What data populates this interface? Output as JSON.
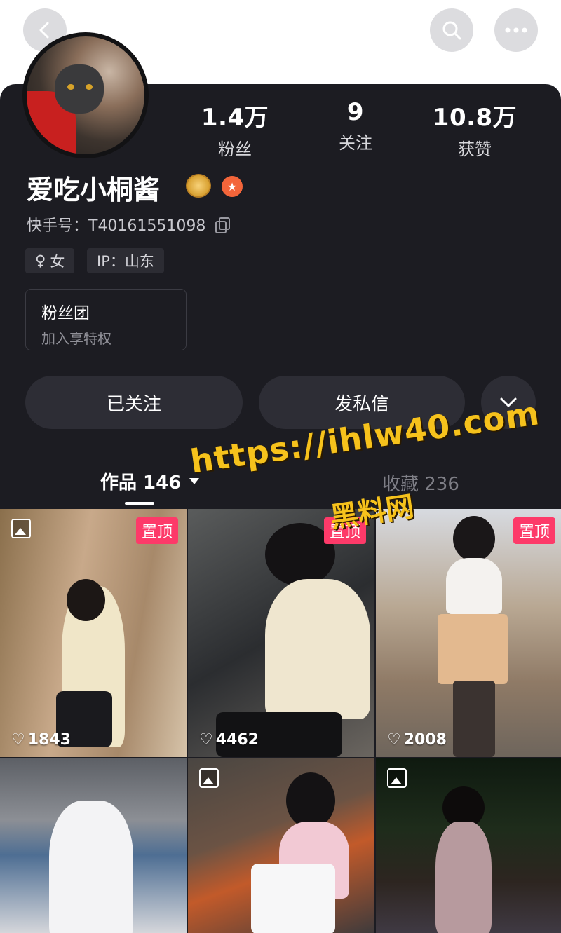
{
  "header": {
    "back_icon": "chevron-left-icon",
    "search_icon": "search-icon",
    "more_icon": "ellipsis-icon"
  },
  "profile": {
    "name": "爱吃小桐酱",
    "kuaishou_id": "快手号：T40161551098",
    "gender_tag": "女",
    "ip_tag": "IP：山东",
    "stats": [
      {
        "value": "1.4万",
        "label": "粉丝"
      },
      {
        "value": "9",
        "label": "关注"
      },
      {
        "value": "10.8万",
        "label": "获赞"
      }
    ]
  },
  "fanclub": {
    "title": "粉丝团",
    "subtitle": "加入享特权"
  },
  "actions": {
    "follow": "已关注",
    "message": "发私信"
  },
  "tabs": {
    "works": "作品 146",
    "favorites": "收藏 236"
  },
  "watermark": {
    "url": "https://ihlw40.com",
    "site": "黑料网"
  },
  "posts": [
    {
      "pinned": "置顶",
      "likes": "1843"
    },
    {
      "pinned": "置顶",
      "likes": "4462"
    },
    {
      "pinned": "置顶",
      "likes": "2008"
    },
    {
      "pinned": "",
      "likes": ""
    },
    {
      "pinned": "",
      "likes": ""
    },
    {
      "pinned": "",
      "likes": ""
    }
  ],
  "colors": {
    "card_bg": "#1c1c22",
    "pin_badge": "#fd3a69",
    "watermark": "#f6c21c"
  }
}
